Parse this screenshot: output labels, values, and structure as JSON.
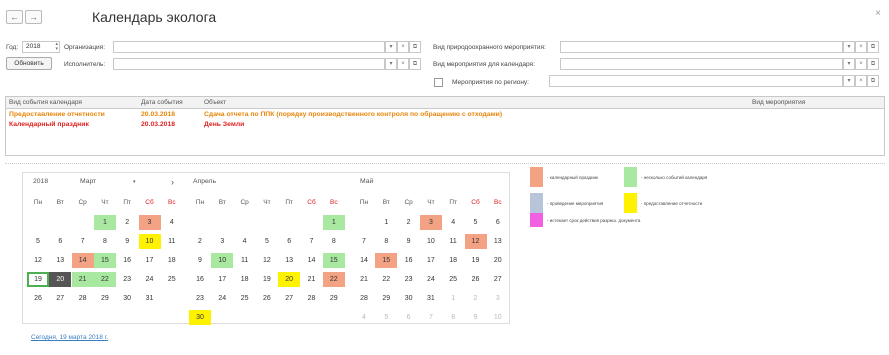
{
  "window": {
    "title": "Календарь эколога",
    "back": "←",
    "forward": "→",
    "close": "×"
  },
  "filters": {
    "year_label": "Год:",
    "year_value": "2018",
    "org_label": "Организация:",
    "org_value": "",
    "executor_label": "Исполнитель:",
    "executor_value": "",
    "refresh_label": "Обновить",
    "nature_event_label": "Вид природоохранного мероприятия:",
    "calendar_event_label": "Вид мероприятия для календаря:",
    "region_label": "Мероприятия по региону:"
  },
  "table": {
    "columns": [
      "Вид события календаря",
      "Дата события",
      "Объект",
      "Вид мероприятия"
    ],
    "rows": [
      {
        "type": "Предоставление отчетности",
        "date": "20.03.2018",
        "object": "Сдача отчета по ППК (порядку производственного контроля по обращению с отходами)",
        "kind": "",
        "color": "#e8850a"
      },
      {
        "type": "Календарный праздник",
        "date": "20.03.2018",
        "object": "День Земли",
        "kind": "",
        "color": "#e0211f"
      }
    ]
  },
  "calendar": {
    "year": "2018",
    "march_name": "Март",
    "april_name": "Апрель",
    "may_name": "Май",
    "nav_next": "›",
    "weekdays": [
      "Пн",
      "Вт",
      "Ср",
      "Чт",
      "Пт",
      "Сб",
      "Вс"
    ],
    "colors": {
      "holiday": "#f4a284",
      "multi": "#a8e8a0",
      "report": "#fff200",
      "selected": "#555555",
      "gray": "#bbbbbb"
    },
    "months": [
      {
        "key": "march",
        "weeks": [
          [
            "",
            "",
            "",
            "1",
            "2",
            "3",
            "4"
          ],
          [
            "5",
            "6",
            "7",
            "8",
            "9",
            "10",
            "11"
          ],
          [
            "12",
            "13",
            "14",
            "15",
            "16",
            "17",
            "18"
          ],
          [
            "19",
            "20",
            "21",
            "22",
            "23",
            "24",
            "25"
          ],
          [
            "26",
            "27",
            "28",
            "29",
            "30",
            "31",
            ""
          ]
        ],
        "marks": {
          "1": "multi",
          "3": "holiday",
          "10": "report",
          "14": "holiday",
          "15": "multi",
          "20": "selected",
          "21": "multi",
          "22": "multi"
        },
        "today": "19",
        "weekendRed": true
      },
      {
        "key": "april",
        "weeks": [
          [
            "",
            "",
            "",
            "",
            "",
            "",
            "1"
          ],
          [
            "2",
            "3",
            "4",
            "5",
            "6",
            "7",
            "8"
          ],
          [
            "9",
            "10",
            "11",
            "12",
            "13",
            "14",
            "15"
          ],
          [
            "16",
            "17",
            "18",
            "19",
            "20",
            "21",
            "22"
          ],
          [
            "23",
            "24",
            "25",
            "26",
            "27",
            "28",
            "29"
          ],
          [
            "30",
            "",
            "",
            "",
            "",
            "",
            ""
          ]
        ],
        "marks": {
          "1": "multi",
          "10": "multi",
          "15": "multi",
          "20": "report",
          "22": "holiday",
          "30": "report"
        }
      },
      {
        "key": "may",
        "weeks": [
          [
            "",
            "1",
            "2",
            "3",
            "4",
            "5",
            "6"
          ],
          [
            "7",
            "8",
            "9",
            "10",
            "11",
            "12",
            "13"
          ],
          [
            "14",
            "15",
            "16",
            "17",
            "18",
            "19",
            "20"
          ],
          [
            "21",
            "22",
            "23",
            "24",
            "25",
            "26",
            "27"
          ],
          [
            "28",
            "29",
            "30",
            "31",
            "1",
            "2",
            "3"
          ],
          [
            "4",
            "5",
            "6",
            "7",
            "8",
            "9",
            "10"
          ]
        ],
        "marks": {
          "3": "holiday",
          "12": "holiday",
          "15": "holiday"
        },
        "grayFrom": [
          4,
          4
        ]
      }
    ],
    "today_link": "Сегодня, 19 марта 2018 г."
  },
  "legend": [
    {
      "text": "- календарный праздник",
      "color": "#f4a284"
    },
    {
      "text": "- несколько событий календаря",
      "color": "#a8e8a0"
    },
    {
      "text": "- проведение мероприятия",
      "color": "#b8c4da"
    },
    {
      "text": "- предоставление отчетности",
      "color": "#fff200"
    },
    {
      "text": "- истекает срок действия разреш. документа",
      "color": "#f060e0"
    }
  ]
}
